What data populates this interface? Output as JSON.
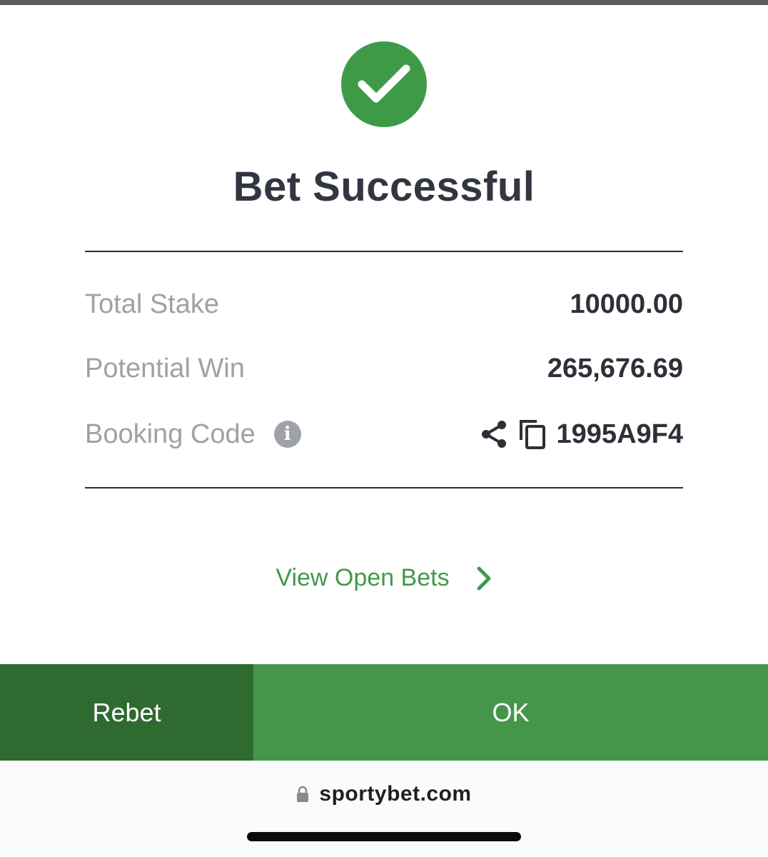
{
  "header": {
    "title": "Bet Successful",
    "status_color": "#3f9a48",
    "status_icon": "checkmark-icon"
  },
  "summary": {
    "total_stake": {
      "label": "Total Stake",
      "value": "10000.00"
    },
    "potential_win": {
      "label": "Potential Win",
      "value": "265,676.69"
    },
    "booking_code": {
      "label": "Booking Code",
      "value": "1995A9F4"
    }
  },
  "icons": {
    "info": "info-icon",
    "share": "share-icon",
    "copy": "copy-icon",
    "chevron": "chevron-right-icon",
    "lock": "lock-icon"
  },
  "links": {
    "view_open_bets": "View Open Bets"
  },
  "actions": {
    "rebet_label": "Rebet",
    "ok_label": "OK",
    "rebet_color": "#2f6b30",
    "ok_color": "#44974a"
  },
  "browser": {
    "url": "sportybet.com"
  }
}
